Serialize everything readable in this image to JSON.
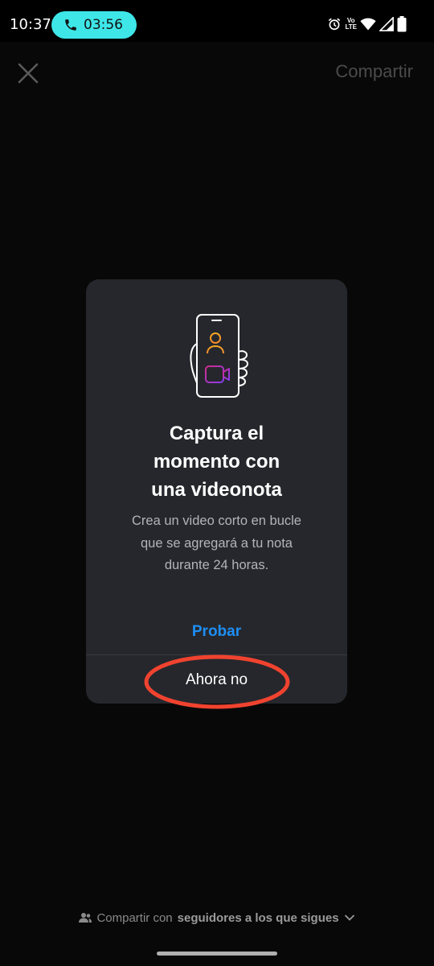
{
  "status_bar": {
    "time": "10:37",
    "call_timer": "03:56",
    "call_pill_color": "#3ee6e8",
    "icons": [
      "alarm-icon",
      "volte-icon",
      "wifi-icon",
      "signal-icon",
      "battery-icon"
    ],
    "volte_label_top": "Vo",
    "volte_label_bottom": "LTE"
  },
  "top_bar": {
    "close_icon": "close-icon",
    "share_label": "Compartir"
  },
  "dialog": {
    "illustration_icon": "phone-video-icon",
    "title_lines": [
      "Captura el",
      "momento con",
      "una videonota"
    ],
    "body_lines": [
      "Crea un video corto en bucle",
      "que se agregará a tu nota",
      "durante 24 horas."
    ],
    "primary_button": "Probar",
    "secondary_button": "Ahora no",
    "primary_color": "#1e8ff5",
    "annotation_color": "#f0432f"
  },
  "footer": {
    "icon": "people-icon",
    "prefix": "Compartir con",
    "audience": "seguidores a los que sigues",
    "chevron_icon": "chevron-down-icon"
  }
}
